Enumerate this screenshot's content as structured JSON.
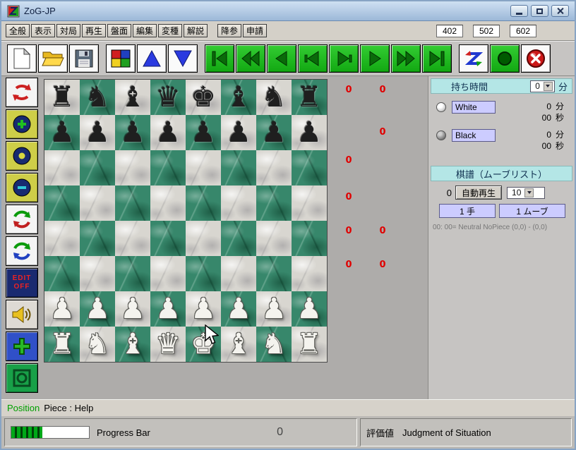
{
  "titlebar": {
    "title": "ZoG-JP"
  },
  "menubar": {
    "menus": [
      {
        "name": "menu-general",
        "label": "全般"
      },
      {
        "name": "menu-view",
        "label": "表示"
      },
      {
        "name": "menu-game",
        "label": "対局"
      },
      {
        "name": "menu-replay",
        "label": "再生"
      },
      {
        "name": "menu-board",
        "label": "盤面"
      },
      {
        "name": "menu-edit",
        "label": "編集"
      },
      {
        "name": "menu-variant",
        "label": "変種"
      },
      {
        "name": "menu-help",
        "label": "解説"
      }
    ],
    "actions": [
      {
        "name": "resign-button",
        "label": "降参"
      },
      {
        "name": "request-button",
        "label": "申請"
      }
    ],
    "codes": [
      {
        "name": "code-402",
        "label": "402"
      },
      {
        "name": "code-502",
        "label": "502"
      },
      {
        "name": "code-602",
        "label": "602"
      }
    ]
  },
  "toolbar": {
    "groups": [
      [
        {
          "name": "new-file"
        },
        {
          "name": "open-folder"
        },
        {
          "name": "save"
        }
      ],
      [
        {
          "name": "display-colors"
        },
        {
          "name": "triangle-up"
        },
        {
          "name": "triangle-down"
        }
      ],
      [
        {
          "name": "nav-start"
        },
        {
          "name": "nav-rewind"
        },
        {
          "name": "nav-back"
        },
        {
          "name": "nav-prev"
        },
        {
          "name": "nav-next"
        },
        {
          "name": "nav-forward"
        },
        {
          "name": "nav-fast-forward"
        },
        {
          "name": "nav-end"
        }
      ],
      [
        {
          "name": "z-moves"
        },
        {
          "name": "record"
        },
        {
          "name": "close-board"
        }
      ]
    ]
  },
  "left_toolbar": [
    {
      "name": "rotate-board"
    },
    {
      "name": "zoom-in"
    },
    {
      "name": "record-dot"
    },
    {
      "name": "zoom-out"
    },
    {
      "name": "refresh-a"
    },
    {
      "name": "refresh-b"
    },
    {
      "name": "edit-off",
      "lines": [
        "EDIT",
        "OFF"
      ]
    },
    {
      "name": "sound"
    },
    {
      "name": "move-cross"
    },
    {
      "name": "snapshot"
    }
  ],
  "board": {
    "glyphs": {
      "r": "♜",
      "n": "♞",
      "b": "♝",
      "q": "♛",
      "k": "♚",
      "p": "♟"
    },
    "rows": [
      [
        "br",
        "bn",
        "bb",
        "bq",
        "bk",
        "bb",
        "bn",
        "br"
      ],
      [
        "bp",
        "bp",
        "bp",
        "bp",
        "bp",
        "bp",
        "bp",
        "bp"
      ],
      [
        "",
        "",
        "",
        "",
        "",
        "",
        "",
        ""
      ],
      [
        "",
        "",
        "",
        "",
        "",
        "",
        "",
        ""
      ],
      [
        "",
        "",
        "",
        "",
        "",
        "",
        "",
        ""
      ],
      [
        "",
        "",
        "",
        "",
        "",
        "",
        "",
        ""
      ],
      [
        "wp",
        "wp",
        "wp",
        "wp",
        "wp",
        "wp",
        "wp",
        "wp"
      ],
      [
        "wr",
        "wn",
        "wb",
        "wq",
        "wk",
        "wb",
        "wn",
        "wr"
      ]
    ]
  },
  "counters": [
    {
      "left": "0",
      "right": "0"
    },
    {
      "left": "",
      "right": "0"
    },
    {
      "left": "0",
      "right": ""
    },
    {
      "left": "0",
      "right": ""
    },
    {
      "left": "0",
      "right": "0"
    },
    {
      "left": "0",
      "right": "0"
    }
  ],
  "time_panel": {
    "title": "持ち時間",
    "dropdown_value": "0",
    "unit": "分",
    "players": [
      {
        "name": "White",
        "minutes": "0",
        "min_unit": "分",
        "seconds": "00",
        "sec_unit": "秒"
      },
      {
        "name": "Black",
        "minutes": "0",
        "min_unit": "分",
        "seconds": "00",
        "sec_unit": "秒"
      }
    ]
  },
  "move_panel": {
    "title": "棋譜（ムーブリスト）",
    "counter": "0",
    "autoplay_label": "自動再生",
    "speed_value": "10",
    "buttons": [
      {
        "name": "one-te-button",
        "label": "1 手"
      },
      {
        "name": "one-move-button",
        "label": "1 ムーブ"
      }
    ],
    "note": "00: 00= Neutral NoPiece (0,0) - (0,0)"
  },
  "status_bar": {
    "position_label": "Position",
    "help_label": "Piece : Help"
  },
  "bottom_bar": {
    "progress_label": "Progress Bar",
    "progress_value": "0",
    "evaluation_label": "評価値",
    "evaluation_text": "Judgment of Situation"
  },
  "colors": {
    "accent_green": "#12a812",
    "counter_red": "#e00000",
    "header_teal": "#b4e6e6",
    "lavender": "#ccccff"
  }
}
